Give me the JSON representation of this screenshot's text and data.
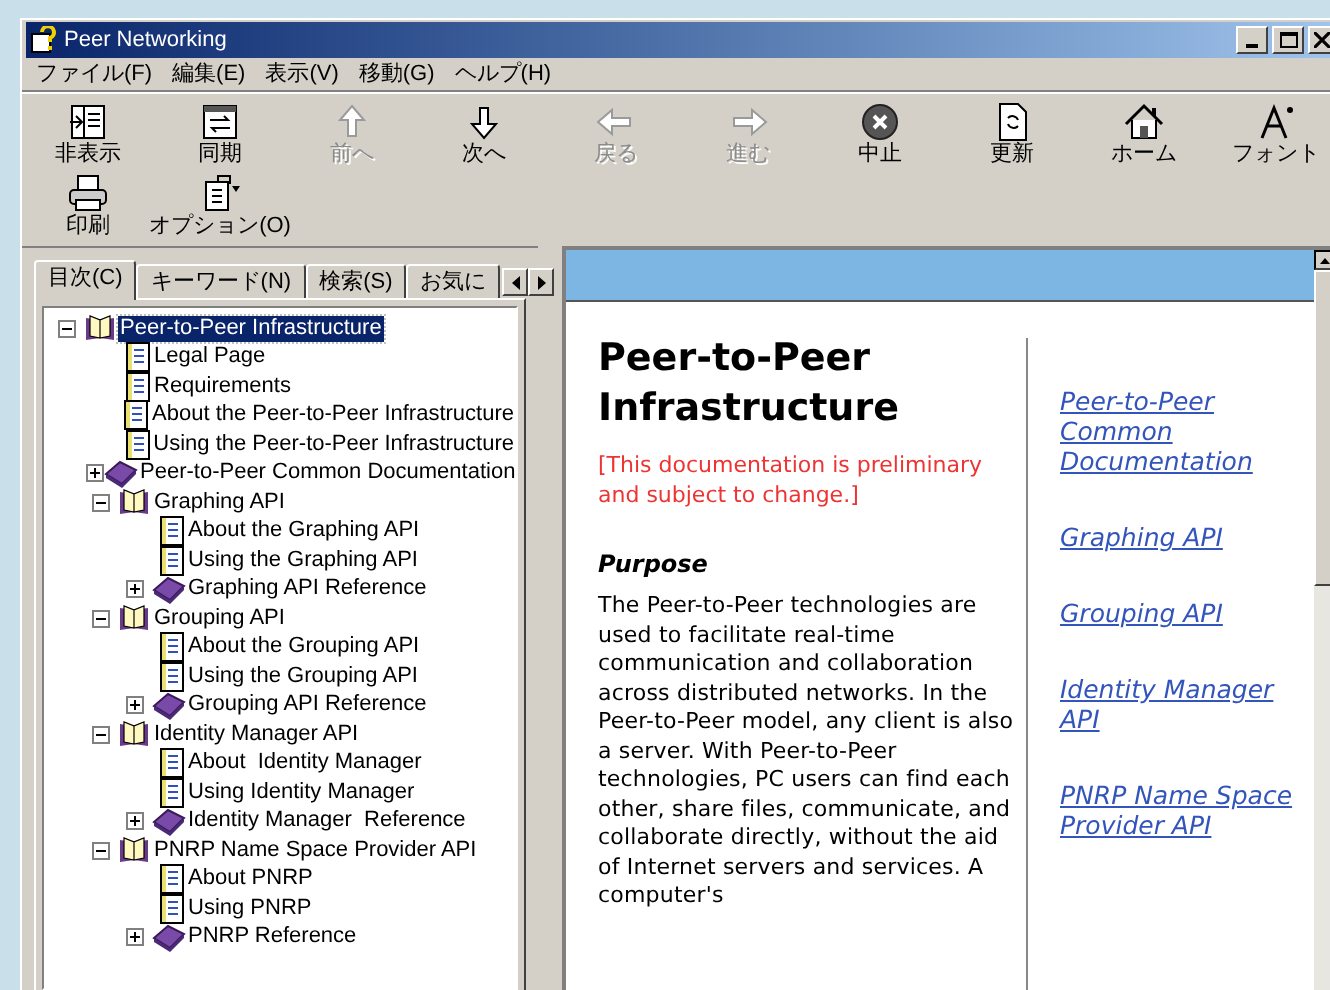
{
  "window": {
    "title": "Peer Networking"
  },
  "menu": [
    "ファイル(F)",
    "編集(E)",
    "表示(V)",
    "移動(G)",
    "ヘルプ(H)"
  ],
  "toolbar": [
    {
      "label": "非表示",
      "disabled": false
    },
    {
      "label": "同期",
      "disabled": false
    },
    {
      "label": "前へ",
      "disabled": true
    },
    {
      "label": "次へ",
      "disabled": false
    },
    {
      "label": "戻る",
      "disabled": true
    },
    {
      "label": "進む",
      "disabled": true
    },
    {
      "label": "中止",
      "disabled": false
    },
    {
      "label": "更新",
      "disabled": false
    },
    {
      "label": "ホーム",
      "disabled": false
    },
    {
      "label": "フォント",
      "disabled": false
    },
    {
      "label": "印刷",
      "disabled": false
    },
    {
      "label": "オプション(O)",
      "disabled": false
    }
  ],
  "tabs": [
    {
      "label": "目次(C)",
      "selected": true
    },
    {
      "label": "キーワード(N)",
      "selected": false
    },
    {
      "label": "検索(S)",
      "selected": false
    },
    {
      "label": "お気に",
      "selected": false
    }
  ],
  "tree": [
    {
      "label": "Peer-to-Peer Infrastructure",
      "kind": "book",
      "expanded": true,
      "selected": true,
      "children": [
        {
          "label": "Legal Page",
          "kind": "page",
          "selected": false
        },
        {
          "label": "Requirements",
          "kind": "page",
          "selected": false
        },
        {
          "label": "About the Peer-to-Peer Infrastructure",
          "kind": "page",
          "selected": false
        },
        {
          "label": "Using the Peer-to-Peer Infrastructure",
          "kind": "page",
          "selected": false
        },
        {
          "label": "Peer-to-Peer Common Documentation",
          "kind": "book",
          "expanded": false,
          "selected": false
        },
        {
          "label": "Graphing API",
          "kind": "book",
          "expanded": true,
          "selected": false,
          "children": [
            {
              "label": "About the Graphing API",
              "kind": "page",
              "selected": false
            },
            {
              "label": "Using the Graphing API",
              "kind": "page",
              "selected": false
            },
            {
              "label": "Graphing API Reference",
              "kind": "book",
              "expanded": false,
              "selected": false
            }
          ]
        },
        {
          "label": "Grouping API",
          "kind": "book",
          "expanded": true,
          "selected": false,
          "children": [
            {
              "label": "About the Grouping API",
              "kind": "page",
              "selected": false
            },
            {
              "label": "Using the Grouping API",
              "kind": "page",
              "selected": false
            },
            {
              "label": "Grouping API Reference",
              "kind": "book",
              "expanded": false,
              "selected": false
            }
          ]
        },
        {
          "label": "Identity Manager API",
          "kind": "book",
          "expanded": true,
          "selected": false,
          "children": [
            {
              "label": "About  Identity Manager",
              "kind": "page",
              "selected": false
            },
            {
              "label": "Using Identity Manager",
              "kind": "page",
              "selected": false
            },
            {
              "label": "Identity Manager  Reference",
              "kind": "book",
              "expanded": false,
              "selected": false
            }
          ]
        },
        {
          "label": "PNRP Name Space Provider API",
          "kind": "book",
          "expanded": true,
          "selected": false,
          "children": [
            {
              "label": "About PNRP",
              "kind": "page",
              "selected": false
            },
            {
              "label": "Using PNRP",
              "kind": "page",
              "selected": false
            },
            {
              "label": "PNRP Reference",
              "kind": "book",
              "expanded": false,
              "selected": false
            }
          ]
        }
      ]
    }
  ],
  "content": {
    "heading": "Peer-to-Peer Infrastructure",
    "notice": "[This documentation is preliminary and subject to change.]",
    "section_title": "Purpose",
    "paragraph": "The Peer-to-Peer technologies are used to facilitate real-time communication and collaboration across distributed networks. In the Peer-to-Peer model, any client is also a server. With Peer-to-Peer technologies, PC users can find each other, share files, communicate, and collaborate directly, without the aid of Internet servers and services. A computer's",
    "links": [
      "Peer-to-Peer Common Documentation",
      "Graphing API",
      "Grouping API",
      "Identity Manager API",
      "PNRP Name Space Provider API"
    ]
  }
}
